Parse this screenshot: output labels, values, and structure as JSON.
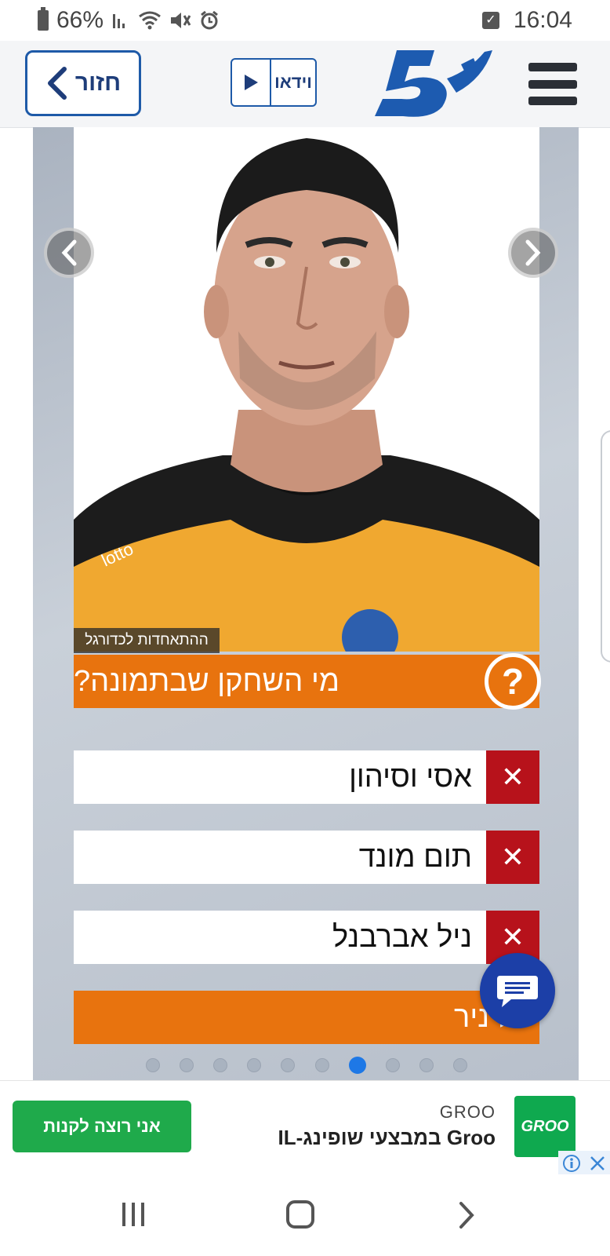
{
  "status_bar": {
    "battery_percent": "66%",
    "time": "16:04"
  },
  "header": {
    "back_label": "חזור",
    "video_label": "וידאו",
    "logo_alt": "5"
  },
  "quiz": {
    "photo_credit": "ההתאחדות לכדורגל",
    "question": "מי השחקן שבתמונה?",
    "question_mark": "?",
    "answers": [
      {
        "label": "אסי וסיהון",
        "state": "wrong",
        "mark": "✕"
      },
      {
        "label": "תום מונד",
        "state": "wrong",
        "mark": "✕"
      },
      {
        "label": "ניל אברבנל",
        "state": "wrong",
        "mark": "✕"
      },
      {
        "label": "גל ניר",
        "state": "correct",
        "mark": ""
      }
    ],
    "pagination": {
      "total": 10,
      "current": 7
    }
  },
  "ad": {
    "cta_label": "אני רוצה לקנות",
    "brand": "GROO",
    "title": "Groo במבצעי שופינג-IL",
    "logo_text": "GROO"
  },
  "colors": {
    "brand_blue": "#1e5aa8",
    "quiz_orange": "#e8730e",
    "wrong_red": "#b7121b",
    "ad_green": "#1faa4b"
  },
  "icons": [
    "battery-icon",
    "signal-icon",
    "wifi-icon",
    "mute-icon",
    "alarm-icon",
    "checkbox-icon",
    "chevron-left-icon",
    "play-icon",
    "menu-icon",
    "chat-icon",
    "info-icon",
    "close-icon",
    "recents-icon",
    "home-icon",
    "back-icon"
  ]
}
